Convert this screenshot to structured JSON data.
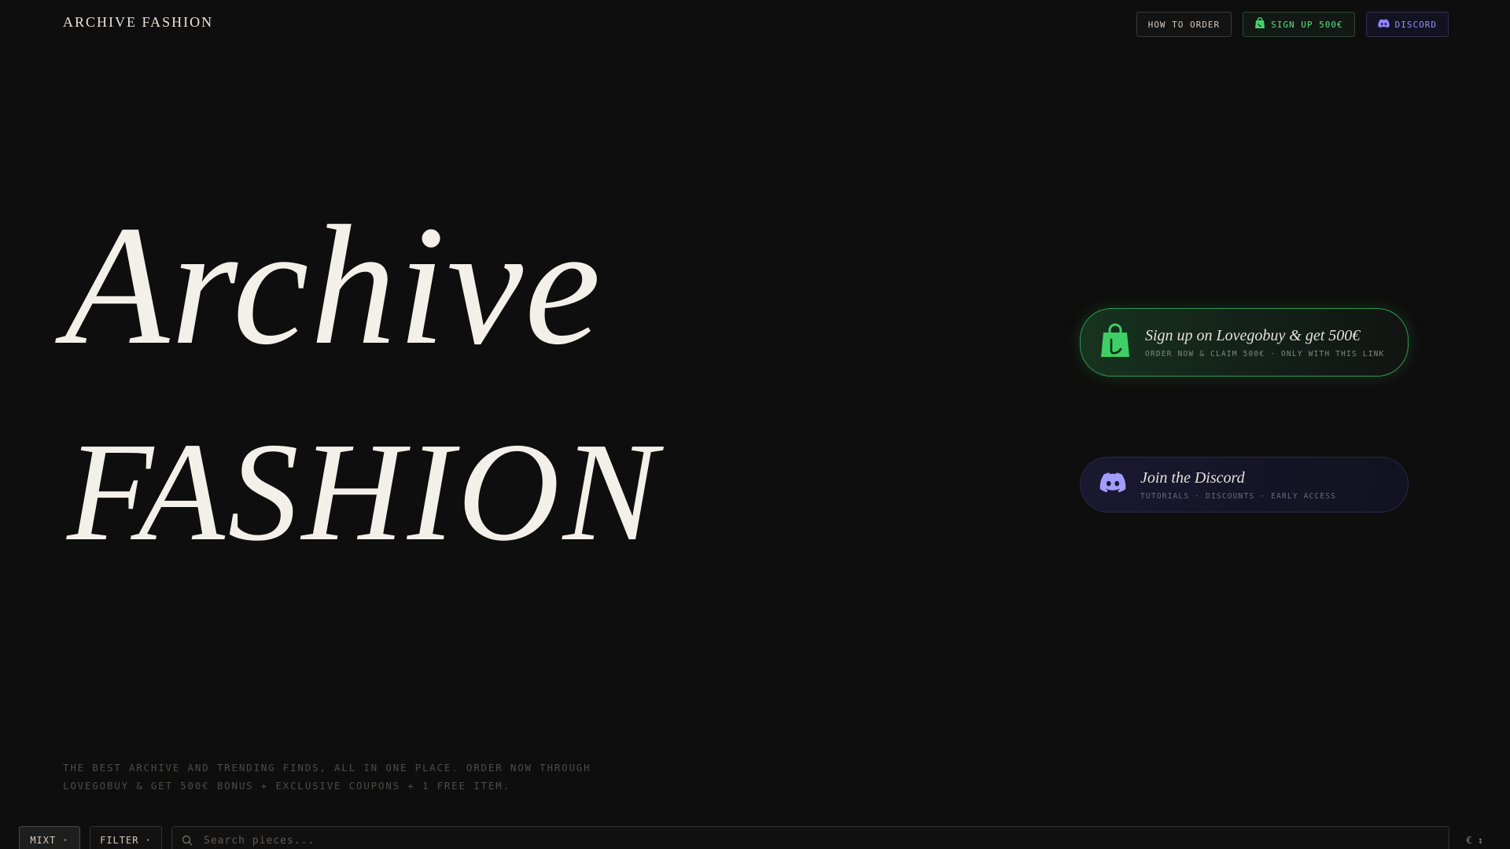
{
  "header": {
    "brand": "ARCHIVE FASHION",
    "nav": {
      "how_to_order": "HOW TO ORDER",
      "sign_up": "SIGN UP 500€",
      "discord": "DISCORD"
    }
  },
  "hero": {
    "line1": "Archive",
    "line2": "FASHION"
  },
  "cards": {
    "lovegobuy": {
      "title": "Sign up on Lovegobuy & get 500€",
      "subtitle": "ORDER NOW & CLAIM 500€ · ONLY WITH THIS LINK",
      "icon": "shopping-bag-icon",
      "accent": "#2f9a51"
    },
    "discord": {
      "title": "Join the Discord",
      "subtitle": "TUTORIALS · DISCOUNTS · EARLY ACCESS",
      "icon": "discord-icon",
      "accent": "#8e85ff"
    }
  },
  "tagline": {
    "line1": "THE BEST ARCHIVE AND TRENDING FINDS, ALL IN ONE PLACE. ORDER NOW THROUGH",
    "line2": "LOVEGOBUY & GET 500€ BONUS + EXCLUSIVE COUPONS + 1 FREE ITEM."
  },
  "toolbar": {
    "mixt": "MIXT ·",
    "filter": "FILTER ·",
    "search_placeholder": "Search pieces...",
    "currency": "€ ↕"
  },
  "colors": {
    "background": "#0f0e0e",
    "green": "#59e084",
    "purple": "#9a92ff"
  }
}
